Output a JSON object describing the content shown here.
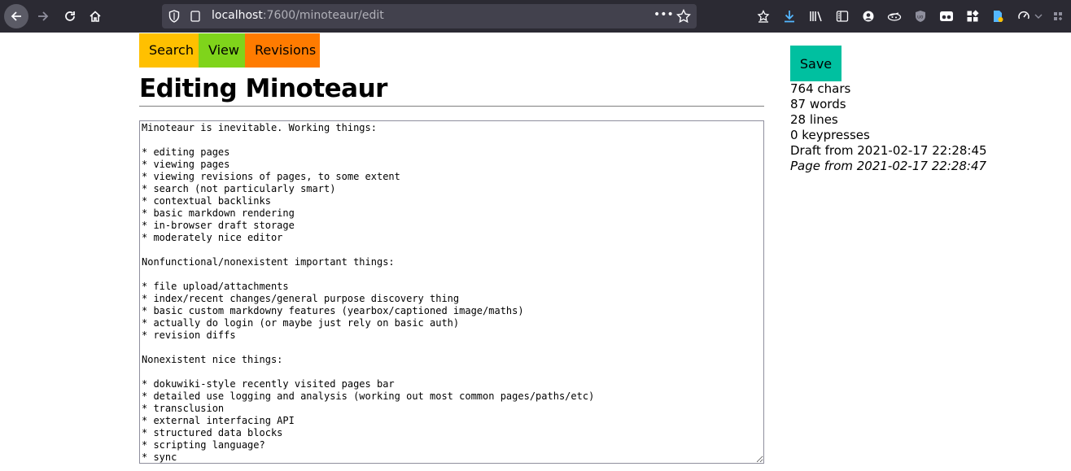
{
  "browser": {
    "url_host": "localhost",
    "url_path": ":7600/minoteaur/edit",
    "more_label": "•••"
  },
  "nav": {
    "search": "Search",
    "view": "View",
    "revisions": "Revisions"
  },
  "page_title": "Editing Minoteaur",
  "editor": {
    "content": "Minoteaur is inevitable. Working things:\n\n* editing pages\n* viewing pages\n* viewing revisions of pages, to some extent\n* search (not particularly smart)\n* contextual backlinks\n* basic markdown rendering\n* in-browser draft storage\n* moderately nice editor\n\nNonfunctional/nonexistent important things:\n\n* file upload/attachments\n* index/recent changes/general purpose discovery thing\n* basic custom markdowny features (yearbox/captioned image/maths)\n* actually do login (or maybe just rely on basic auth)\n* revision diffs\n\nNonexistent nice things:\n\n* dokuwiki-style recently visited pages bar\n* detailed use logging and analysis (working out most common pages/paths/etc)\n* transclusion\n* external interfacing API\n* structured data blocks\n* scripting language?\n* sync"
  },
  "sidebar": {
    "save_label": "Save",
    "chars": "764 chars",
    "words": "87 words",
    "lines": "28 lines",
    "keypresses": "0 keypresses",
    "draft_from": "Draft from 2021-02-17 22:28:45",
    "page_from": "Page from 2021-02-17 22:28:47"
  },
  "colors": {
    "search_tab": "#ffc000",
    "view_tab": "#7fd41b",
    "revisions_tab": "#ff7b00",
    "save_button": "#00c0a0",
    "toolbar": "#2b2a33"
  }
}
